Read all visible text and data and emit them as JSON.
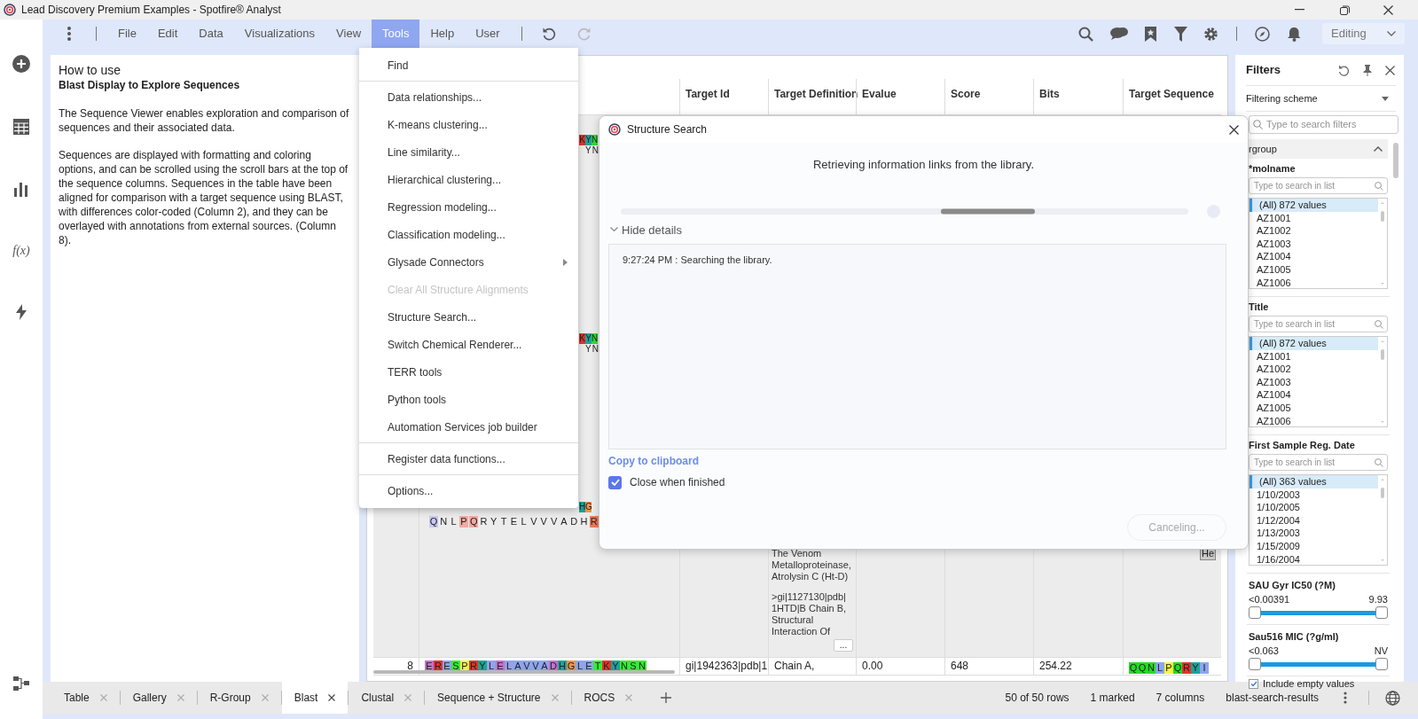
{
  "window": {
    "title": "Lead Discovery Premium Examples - Spotfire® Analyst"
  },
  "menu_bar": {
    "items": [
      {
        "label": "File",
        "selected": false
      },
      {
        "label": "Edit",
        "selected": false
      },
      {
        "label": "Data",
        "selected": false
      },
      {
        "label": "Visualizations",
        "selected": false
      },
      {
        "label": "View",
        "selected": false
      },
      {
        "label": "Tools",
        "selected": true
      },
      {
        "label": "Help",
        "selected": false
      },
      {
        "label": "User",
        "selected": false
      }
    ],
    "redo_disabled": true,
    "mode": "Editing"
  },
  "left_rail": {
    "formula_label": "f(x)"
  },
  "text_panel": {
    "heading": "How to use",
    "subheading": "Blast Display to Explore Sequences",
    "paragraphs": [
      "The Sequence Viewer enables exploration and comparison of sequences and their associated data.",
      "Sequences are displayed with formatting and coloring options, and can be scrolled using the scroll bars at the top of the sequence columns. Sequences in the table have been aligned for comparison with a target sequence using BLAST, with differences color-coded (Column 2), and they can be overlayed with annotations from external sources. (Column 8)."
    ]
  },
  "table": {
    "columns": [
      "",
      "",
      "Target Id",
      "Target Definition",
      "Evalue",
      "Score",
      "Bits",
      "Target Sequence"
    ],
    "rows": [
      {
        "marked": true,
        "fragments": [
          {
            "colored": [
              {
                "residue": "K",
                "color": "#e8312a"
              },
              {
                "residue": "Y",
                "color": "#1aa39a"
              },
              {
                "residue": "N",
                "color": "#33dd33"
              }
            ],
            "plain": "YN"
          },
          {
            "colored": [
              {
                "residue": "K",
                "color": "#e8312a"
              },
              {
                "residue": "Y",
                "color": "#1aa39a"
              },
              {
                "residue": "N",
                "color": "#33dd33"
              }
            ],
            "plain": "YN"
          },
          {
            "colored": [
              {
                "residue": "H",
                "color": "#1aa39a"
              },
              {
                "residue": "G",
                "color": "#f0934a"
              }
            ]
          }
        ],
        "query_line": [
          {
            "residue": "Q",
            "color": "#c9c9f2"
          },
          {
            "residue": "N"
          },
          {
            "residue": "L"
          },
          {
            "residue": "P",
            "color": "#f2aaa2"
          },
          {
            "residue": "Q",
            "color": "#f2aaa2"
          },
          {
            "residue": "R"
          },
          {
            "residue": "Y"
          },
          {
            "residue": "T"
          },
          {
            "residue": "E"
          },
          {
            "residue": "L"
          },
          {
            "residue": "V"
          },
          {
            "residue": "V"
          },
          {
            "residue": "V"
          },
          {
            "residue": "A"
          },
          {
            "residue": "D"
          },
          {
            "residue": "H"
          },
          {
            "residue": "R",
            "color": "#f07a5a"
          }
        ],
        "target_definition": [
          [
            "The Venom",
            "Metalloproteinase,",
            "Atrolysin C (Ht-D)"
          ],
          [
            ">gi|1127130|pdb|",
            "1HTD|B Chain B,",
            "Structural",
            "Interaction Of"
          ]
        ],
        "more_button": "...",
        "annotation": "He"
      },
      {
        "marked": false,
        "number": "8",
        "sequence": [
          {
            "residue": "E",
            "color": "#c46fd0"
          },
          {
            "residue": "R",
            "color": "#e8312a"
          },
          {
            "residue": "E",
            "color": "#8ea4f0"
          },
          {
            "residue": "S",
            "color": "#33ee33"
          },
          {
            "residue": "P",
            "color": "#f5f542"
          },
          {
            "residue": "R",
            "color": "#e8312a"
          },
          {
            "residue": "Y",
            "color": "#1aa39a"
          },
          {
            "residue": "L",
            "color": "#8ea4f0"
          },
          {
            "residue": "E",
            "color": "#c46fd0"
          },
          {
            "residue": "L",
            "color": "#8ea4f0"
          },
          {
            "residue": "A",
            "color": "#8ea4f0"
          },
          {
            "residue": "V",
            "color": "#8ea4f0"
          },
          {
            "residue": "V",
            "color": "#8ea4f0"
          },
          {
            "residue": "A",
            "color": "#8ea4f0"
          },
          {
            "residue": "D",
            "color": "#c46fd0"
          },
          {
            "residue": "H",
            "color": "#1aa39a"
          },
          {
            "residue": "G",
            "color": "#f0934a"
          },
          {
            "residue": "L",
            "color": "#8ea4f0"
          },
          {
            "residue": "E",
            "color": "#8ea4f0"
          },
          {
            "residue": "T",
            "color": "#33ee33"
          },
          {
            "residue": "K",
            "color": "#e8312a"
          },
          {
            "residue": "Y",
            "color": "#1aa39a"
          },
          {
            "residue": "N",
            "color": "#33ee33"
          },
          {
            "residue": "S",
            "color": "#33ee33"
          },
          {
            "residue": "N",
            "color": "#33ee33"
          }
        ],
        "target_id": "gi|1942363|pdb|1",
        "target_definition": [
          "Chain A,"
        ],
        "evalue": "0.00",
        "score": "648",
        "bits": "254.22",
        "target_sequence": [
          {
            "residue": "Q",
            "color": "#22dd22"
          },
          {
            "residue": "Q",
            "color": "#22dd22"
          },
          {
            "residue": "N",
            "color": "#22dd22"
          },
          {
            "residue": "L",
            "color": "#8ea4f0"
          },
          {
            "residue": "P",
            "color": "#f5f542"
          },
          {
            "residue": "Q",
            "color": "#22dd22"
          },
          {
            "residue": "R",
            "color": "#e8312a"
          },
          {
            "residue": "Y",
            "color": "#1aa39a"
          },
          {
            "residue": "I",
            "color": "#8ea4f0"
          }
        ]
      }
    ]
  },
  "tools_menu": {
    "groups": [
      [
        {
          "label": "Find",
          "disabled": false,
          "submenu": false
        }
      ],
      [
        {
          "label": "Data relationships...",
          "disabled": false,
          "submenu": false
        },
        {
          "label": "K-means clustering...",
          "disabled": false,
          "submenu": false
        },
        {
          "label": "Line similarity...",
          "disabled": false,
          "submenu": false
        },
        {
          "label": "Hierarchical clustering...",
          "disabled": false,
          "submenu": false
        },
        {
          "label": "Regression modeling...",
          "disabled": false,
          "submenu": false
        },
        {
          "label": "Classification modeling...",
          "disabled": false,
          "submenu": false
        },
        {
          "label": "Glysade Connectors",
          "disabled": false,
          "submenu": true
        },
        {
          "label": "Clear All Structure Alignments",
          "disabled": true,
          "submenu": false
        },
        {
          "label": "Structure Search...",
          "disabled": false,
          "submenu": false
        },
        {
          "label": "Switch Chemical Renderer...",
          "disabled": false,
          "submenu": false
        },
        {
          "label": "TERR tools",
          "disabled": false,
          "submenu": false
        },
        {
          "label": "Python tools",
          "disabled": false,
          "submenu": false
        },
        {
          "label": "Automation Services job builder",
          "disabled": false,
          "submenu": false
        }
      ],
      [
        {
          "label": "Register data functions...",
          "disabled": false,
          "submenu": false
        }
      ],
      [
        {
          "label": "Options...",
          "disabled": false,
          "submenu": false
        }
      ]
    ]
  },
  "dialog": {
    "title": "Structure Search",
    "message": "Retrieving information links from the library.",
    "details": {
      "label": "Hide details",
      "expanded": true,
      "log": "9:27:24 PM : Searching the library."
    },
    "copy_link": "Copy to clipboard",
    "close_when_finished": {
      "label": "Close when finished",
      "checked": true
    },
    "button": {
      "label": "Canceling...",
      "disabled": true
    }
  },
  "filters": {
    "title": "Filters",
    "scheme": "Filtering scheme",
    "search_placeholder": "Type to search filters",
    "group": {
      "label": "rgroup",
      "expanded": true
    },
    "items": [
      {
        "kind": "list",
        "label": "*molname",
        "placeholder": "Type to search in list",
        "values": [
          {
            "label": "(All) 872 values",
            "selected": true
          },
          {
            "label": "AZ1001",
            "selected": false
          },
          {
            "label": "AZ1002",
            "selected": false
          },
          {
            "label": "AZ1003",
            "selected": false
          },
          {
            "label": "AZ1004",
            "selected": false
          },
          {
            "label": "AZ1005",
            "selected": false
          },
          {
            "label": "AZ1006",
            "selected": false
          }
        ]
      },
      {
        "kind": "list",
        "label": "Title",
        "placeholder": "Type to search in list",
        "values": [
          {
            "label": "(All) 872 values",
            "selected": true
          },
          {
            "label": "AZ1001",
            "selected": false
          },
          {
            "label": "AZ1002",
            "selected": false
          },
          {
            "label": "AZ1003",
            "selected": false
          },
          {
            "label": "AZ1004",
            "selected": false
          },
          {
            "label": "AZ1005",
            "selected": false
          },
          {
            "label": "AZ1006",
            "selected": false
          }
        ]
      },
      {
        "kind": "list",
        "label": "First Sample Reg. Date",
        "placeholder": "Type to search in list",
        "values": [
          {
            "label": "(All) 363 values",
            "selected": true
          },
          {
            "label": "1/10/2003",
            "selected": false
          },
          {
            "label": "1/10/2005",
            "selected": false
          },
          {
            "label": "1/12/2004",
            "selected": false
          },
          {
            "label": "1/13/2003",
            "selected": false
          },
          {
            "label": "1/15/2009",
            "selected": false
          },
          {
            "label": "1/16/2004",
            "selected": false
          }
        ]
      },
      {
        "kind": "range",
        "label": "SAU Gyr IC50 (?M)",
        "min": "<0.00391",
        "max": "9.93",
        "level": 1
      },
      {
        "kind": "range",
        "label": "Sau516 MIC (?g/ml)",
        "min": "<0.063",
        "max": "NV",
        "level": 1
      },
      {
        "kind": "checkbox",
        "label": "Include empty values",
        "checked": true
      }
    ]
  },
  "tabs": [
    {
      "label": "Table",
      "selected": false
    },
    {
      "label": "Gallery",
      "selected": false
    },
    {
      "label": "R-Group",
      "selected": false
    },
    {
      "label": "Blast",
      "selected": true
    },
    {
      "label": "Clustal",
      "selected": false
    },
    {
      "label": "Sequence + Structure",
      "selected": false
    },
    {
      "label": "ROCS",
      "selected": false
    }
  ],
  "status_bar": [
    "50 of 50 rows",
    "1 marked",
    "7 columns",
    "blast-search-results"
  ]
}
